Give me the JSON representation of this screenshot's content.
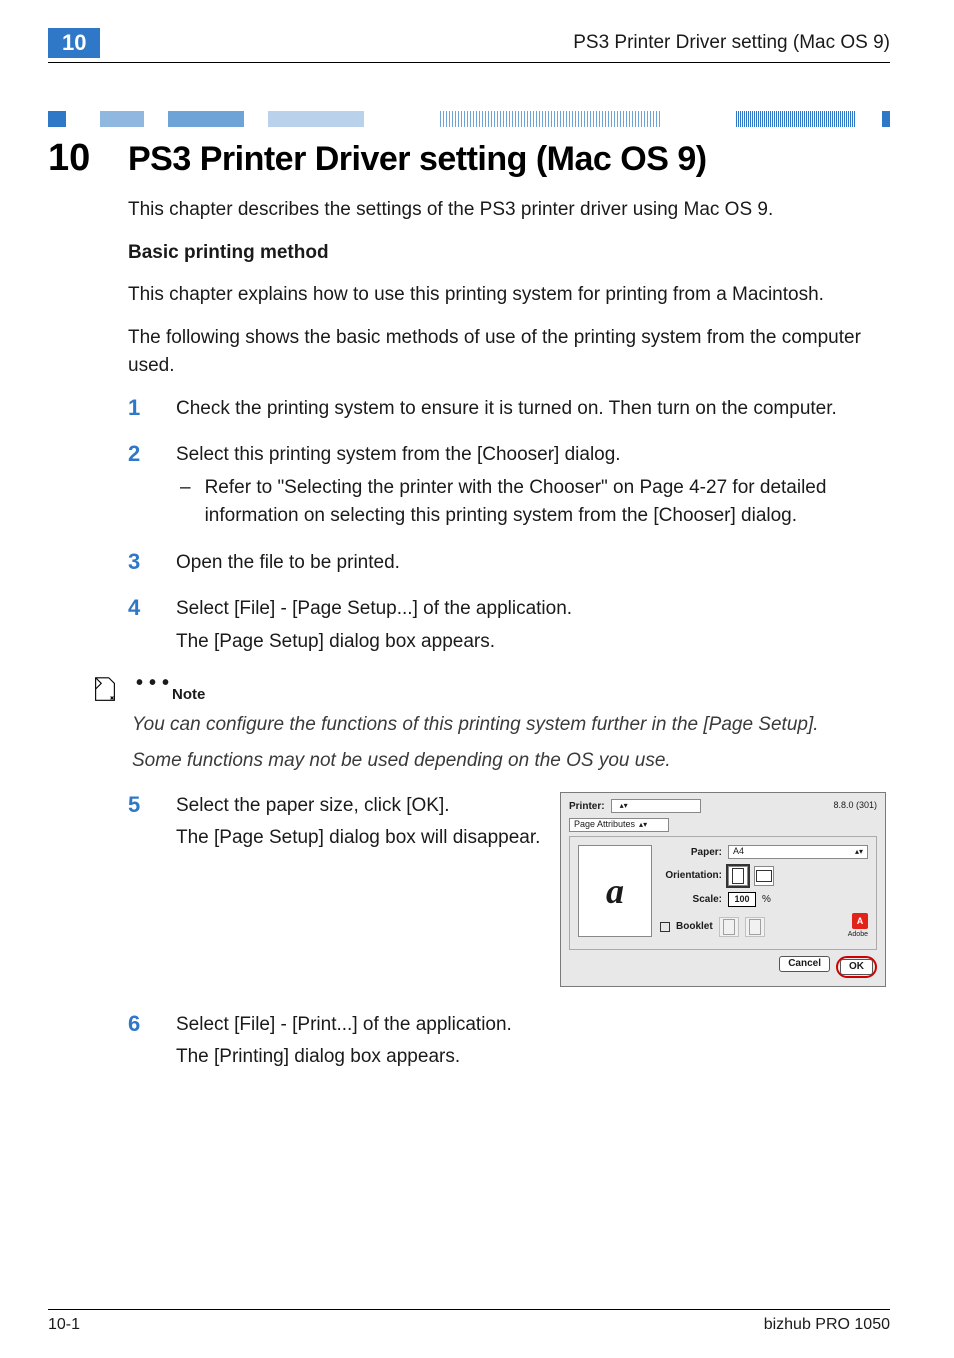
{
  "header": {
    "chapter_tab": "10",
    "running_title": "PS3 Printer Driver setting (Mac OS 9)"
  },
  "title": {
    "number": "10",
    "text": "PS3 Printer Driver setting (Mac OS 9)"
  },
  "intro": "This chapter describes the settings of the PS3 printer driver using Mac OS 9.",
  "section_subhead": "Basic printing method",
  "section_lead1": "This chapter explains how to use this printing system for printing from a Macintosh.",
  "section_lead2": "The following shows the basic methods of use of the printing system from the computer used.",
  "steps": {
    "s1": "Check the printing system to ensure it is turned on. Then turn on the computer.",
    "s2": "Select this printing system from the [Chooser] dialog.",
    "s2_sub": "Refer to \"Selecting the printer with the Chooser\" on Page 4-27 for detailed information on selecting this printing system from the [Chooser] dialog.",
    "s3": "Open the file to be printed.",
    "s4a": "Select [File] - [Page Setup...] of the application.",
    "s4b": "The [Page Setup] dialog box appears.",
    "s5a": "Select the paper size, click [OK].",
    "s5b": "The [Page Setup] dialog box will disappear.",
    "s6a": "Select [File] - [Print...] of the application.",
    "s6b": "The [Printing] dialog box appears."
  },
  "note": {
    "label": "Note",
    "line1": "You can configure the functions of this printing system further in the [Page Setup].",
    "line2": "Some functions may not be used depending on the OS you use."
  },
  "screenshot": {
    "printer_label": "Printer:",
    "printer_value": "",
    "version": "8.8.0 (301)",
    "pane_label": "Page Attributes",
    "paper_label": "Paper:",
    "paper_value": "A4",
    "orientation_label": "Orientation:",
    "scale_label": "Scale:",
    "scale_value": "100",
    "scale_suffix": "%",
    "booklet_label": "Booklet",
    "adobe_logo": "A",
    "adobe_sub": "Adobe",
    "preview_letter": "a",
    "cancel": "Cancel",
    "ok": "OK"
  },
  "footer": {
    "left": "10-1",
    "right": "bizhub PRO 1050"
  },
  "nums": {
    "n1": "1",
    "n2": "2",
    "n3": "3",
    "n4": "4",
    "n5": "5",
    "n6": "6"
  }
}
